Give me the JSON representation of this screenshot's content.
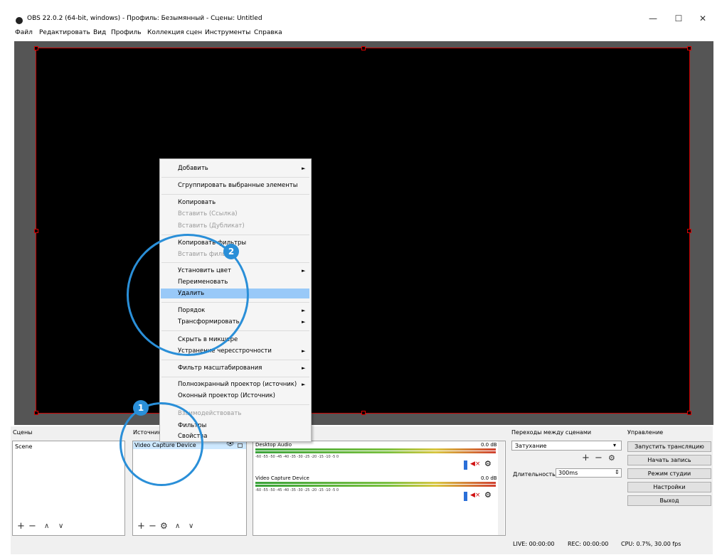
{
  "window": {
    "title": "OBS 22.0.2 (64-bit, windows) - Профиль: Безымянный - Сцены: Untitled",
    "minimize": "—",
    "maximize": "☐",
    "close": "✕"
  },
  "menu": [
    "Файл",
    "Редактировать",
    "Вид",
    "Профиль",
    "Коллекция сцен",
    "Инструменты",
    "Справка"
  ],
  "docks": {
    "scenes": {
      "title": "Сцены",
      "items": [
        "Scene"
      ]
    },
    "sources": {
      "title": "Источники",
      "items": [
        "Video Capture Device"
      ]
    },
    "mixer": {
      "channels": [
        {
          "name": "Desktop Audio",
          "level": "0.0 dB"
        },
        {
          "name": "Video Capture Device",
          "level": "0.0 dB"
        }
      ],
      "ticks": "-60  -55  -50  -45  -40  -35  -30  -25  -20  -15  -10   -5   0"
    },
    "transitions": {
      "title": "Переходы между сценами",
      "selected": "Затухание",
      "duration_label": "Длительность",
      "duration_value": "300ms"
    },
    "controls": {
      "title": "Управление",
      "buttons": [
        "Запустить трансляцию",
        "Начать запись",
        "Режим студии",
        "Настройки",
        "Выход"
      ]
    }
  },
  "context_menu": {
    "items": [
      {
        "label": "Добавить",
        "disabled": false,
        "submenu": true
      },
      {
        "label": "Сгруппировать выбранные элементы",
        "disabled": false,
        "submenu": false
      },
      {
        "label": "Копировать",
        "disabled": false,
        "submenu": false
      },
      {
        "label": "Вставить (Ссылка)",
        "disabled": true,
        "submenu": false
      },
      {
        "label": "Вставить (Дубликат)",
        "disabled": true,
        "submenu": false
      },
      {
        "label": "Копировать фильтры",
        "disabled": false,
        "submenu": false
      },
      {
        "label": "Вставить фильтры",
        "disabled": true,
        "submenu": false
      },
      {
        "label": "Установить цвет",
        "disabled": false,
        "submenu": true
      },
      {
        "label": "Переименовать",
        "disabled": false,
        "submenu": false
      },
      {
        "label": "Удалить",
        "disabled": false,
        "submenu": false,
        "highlighted": true
      },
      {
        "label": "Порядок",
        "disabled": false,
        "submenu": true
      },
      {
        "label": "Трансформировать",
        "disabled": false,
        "submenu": true
      },
      {
        "label": "Скрыть в микшере",
        "disabled": false,
        "submenu": false
      },
      {
        "label": "Устранение чересстрочности",
        "disabled": false,
        "submenu": true
      },
      {
        "label": "Фильтр масштабирования",
        "disabled": false,
        "submenu": true
      },
      {
        "label": "Полноэкранный проектор (источник)",
        "disabled": false,
        "submenu": true
      },
      {
        "label": "Оконный проектор (Источник)",
        "disabled": false,
        "submenu": false
      },
      {
        "label": "Взаимодействовать",
        "disabled": true,
        "submenu": false
      },
      {
        "label": "Фильтры",
        "disabled": false,
        "submenu": false
      },
      {
        "label": "Свойства",
        "disabled": false,
        "submenu": false
      }
    ],
    "arrow": "►"
  },
  "annotations": {
    "step1": "1",
    "step2": "2"
  },
  "status": {
    "live": "LIVE: 00:00:00",
    "rec": "REC: 00:00:00",
    "cpu": "CPU: 0.7%, 30.00 fps"
  },
  "icons": {
    "plus": "+",
    "minus": "−",
    "up": "∧",
    "down": "∨",
    "gear": "⚙",
    "eye": "👁",
    "dropdown": "▾",
    "spinner": "⇕"
  },
  "colors": {
    "accent": "#2a8fd8",
    "highlight": "#99c9f8",
    "canvas_border": "#cc0000"
  }
}
